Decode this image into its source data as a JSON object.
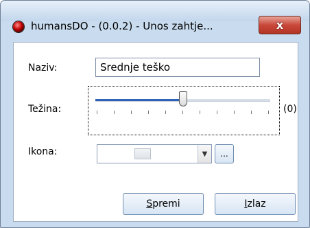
{
  "window": {
    "title": "humansDO - (0.0.2) - Unos zahtje...",
    "close_glyph": "x"
  },
  "form": {
    "naziv_label": "Naziv:",
    "naziv_value": "Srednje teško",
    "tezina_label": "Težina:",
    "tezina_value_text": "(0)",
    "tezina_level_fraction": 0.5,
    "ikona_label": "Ikona:",
    "ikona_arrow": "▼",
    "browse_label": "..."
  },
  "buttons": {
    "save_first": "S",
    "save_rest": "premi",
    "exit_first": "I",
    "exit_rest": "zlaz"
  },
  "icons": {
    "app": "app-red-ball-icon",
    "image_placeholder": "image-placeholder-icon",
    "close": "close-icon",
    "dropdown": "chevron-down-icon"
  }
}
